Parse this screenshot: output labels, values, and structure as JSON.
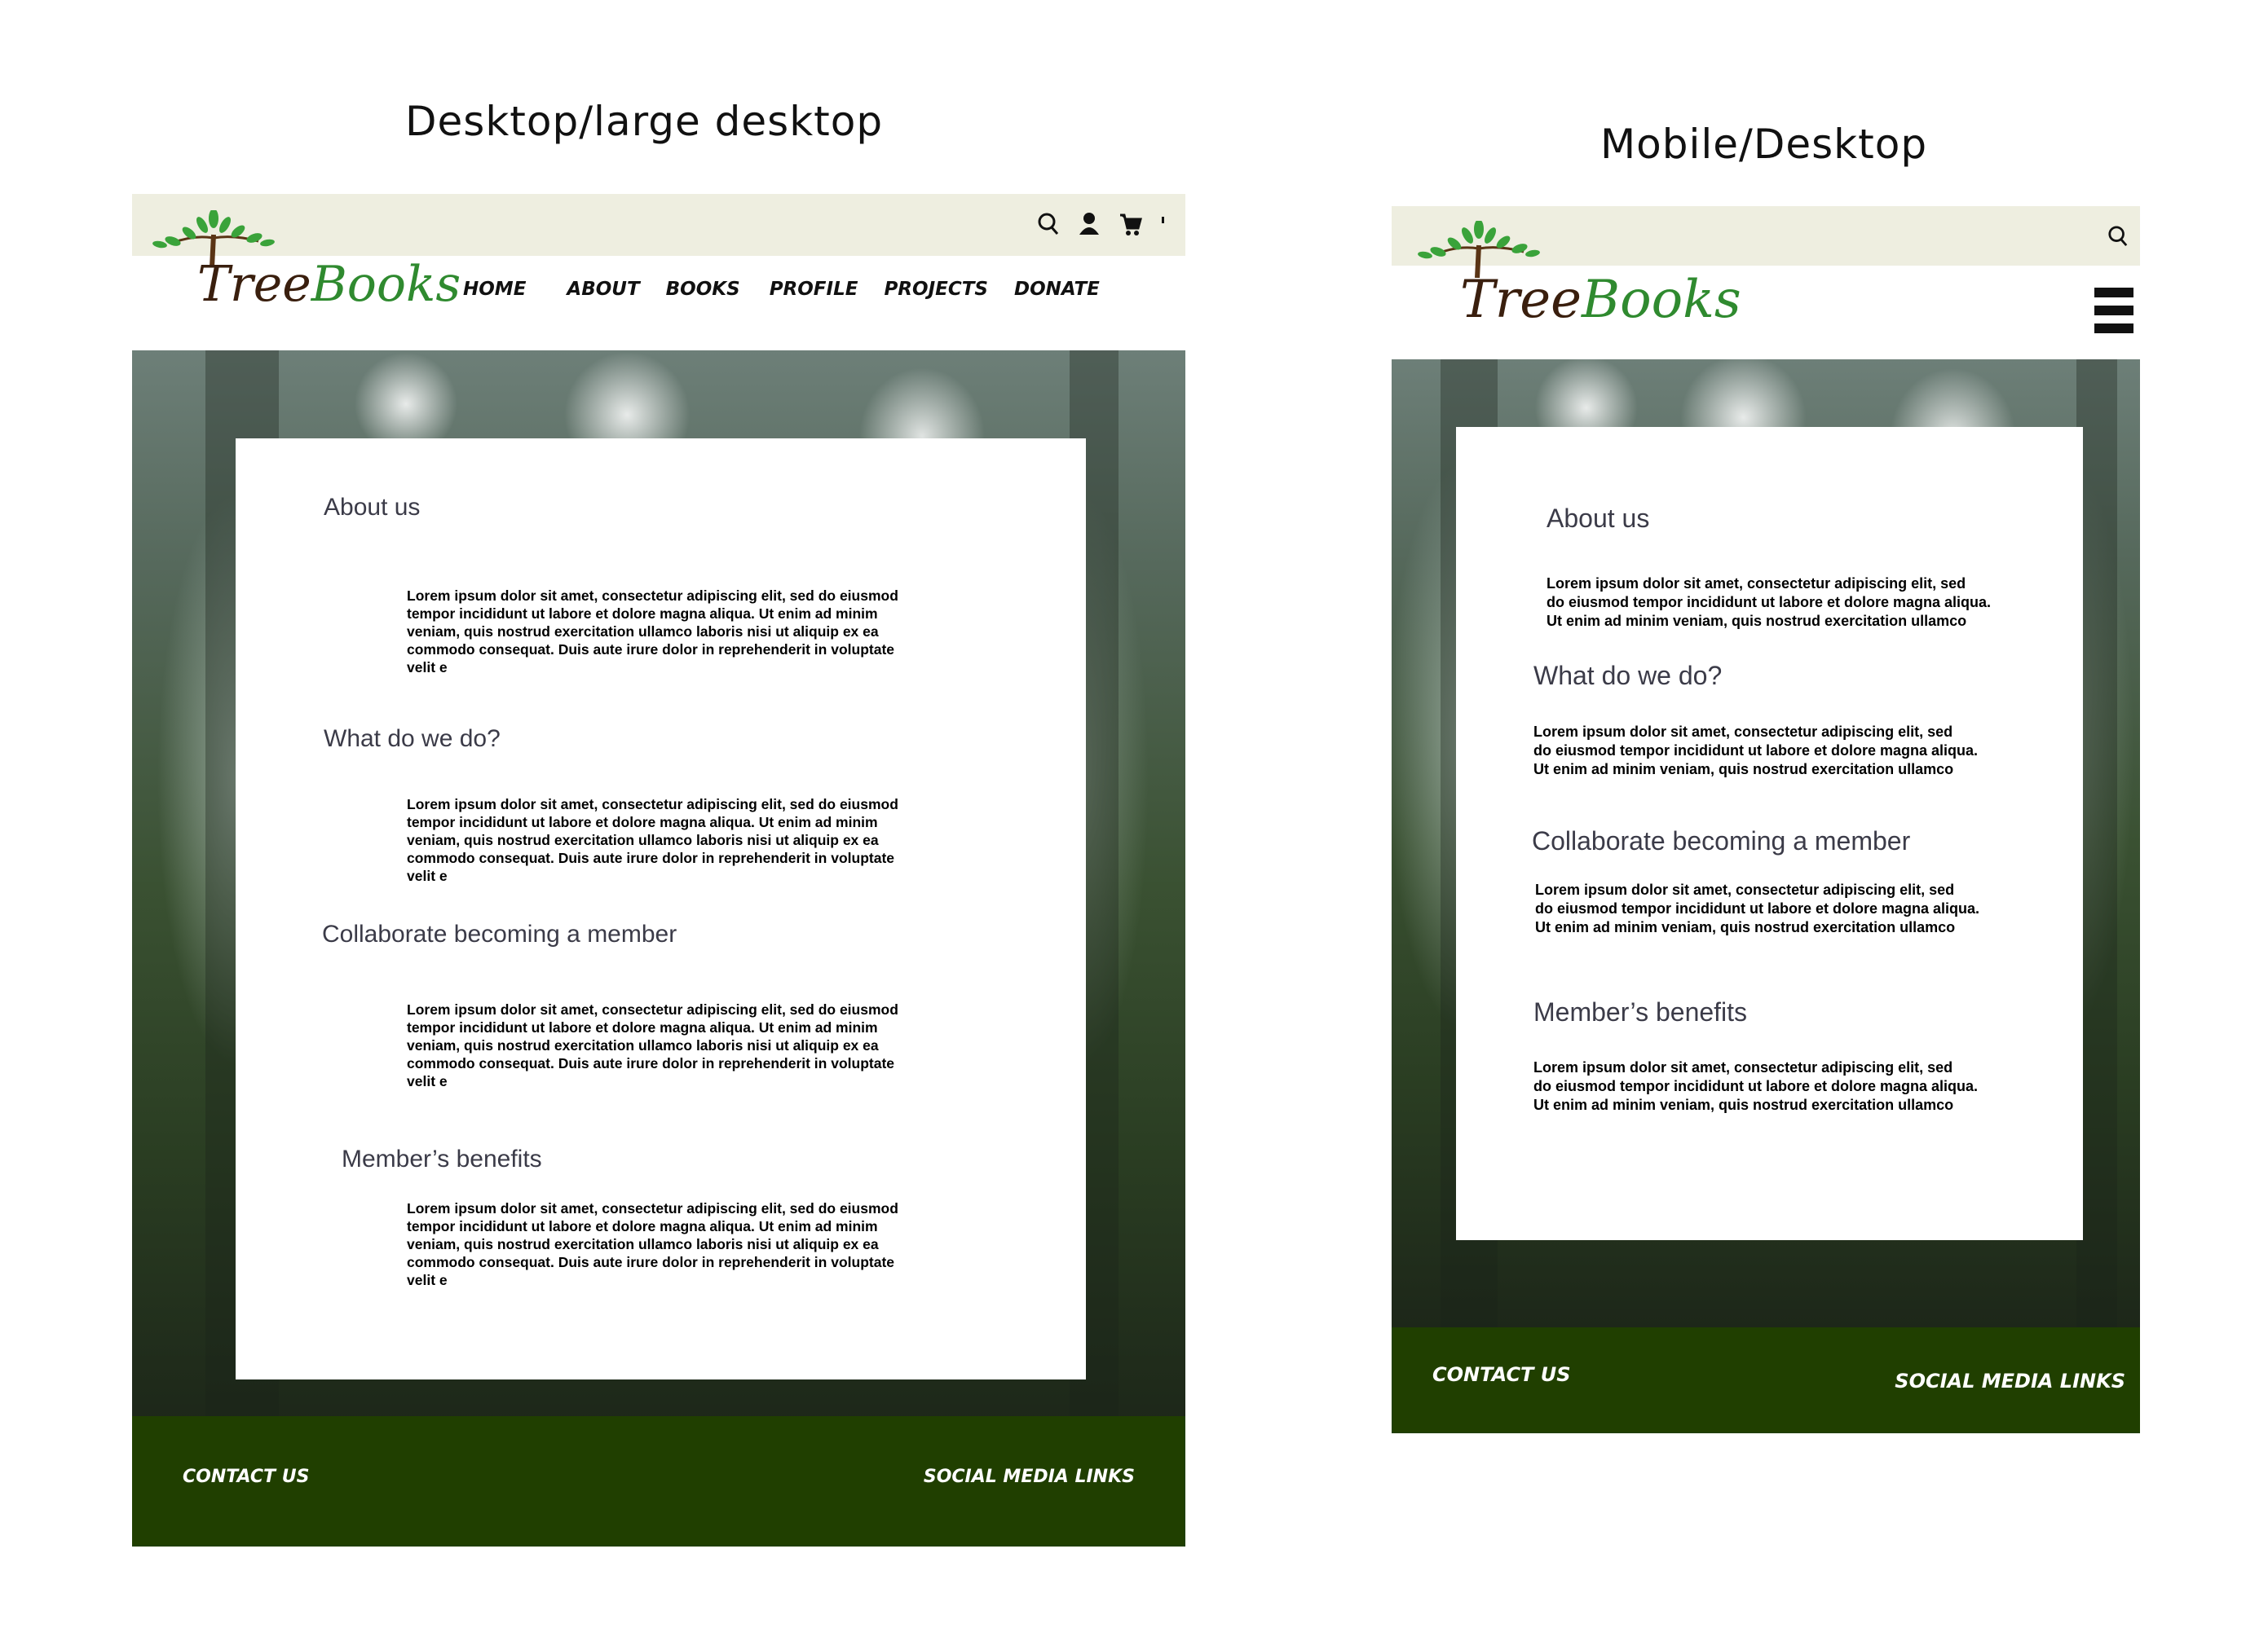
{
  "captions": {
    "desktop": "Desktop/large desktop",
    "mobile": "Mobile/Desktop"
  },
  "brand": {
    "logo_text": "TreeBooks",
    "logo_prefix": "Tree",
    "logo_suffix": "Books"
  },
  "desktop": {
    "header_icons": [
      "search-icon",
      "user-icon",
      "cart-icon"
    ],
    "nav": [
      "HOME",
      "ABOUT",
      "BOOKS",
      "PROFILE",
      "PROJECTS",
      "DONATE"
    ],
    "sections": [
      {
        "heading": "About us",
        "text": "Lorem ipsum dolor sit amet, consectetur adipiscing elit, sed do eiusmod\n tempor incididunt ut labore et dolore magna aliqua. Ut enim ad minim\nveniam, quis nostrud exercitation ullamco laboris nisi ut aliquip ex ea\ncommodo consequat. Duis aute irure dolor in reprehenderit in voluptate\nvelit e"
      },
      {
        "heading": "What do we do?",
        "text": "Lorem ipsum dolor sit amet, consectetur adipiscing elit, sed do eiusmod\n tempor incididunt ut labore et dolore magna aliqua. Ut enim ad minim\nveniam, quis nostrud exercitation ullamco laboris nisi ut aliquip ex ea\ncommodo consequat. Duis aute irure dolor in reprehenderit in voluptate\nvelit e"
      },
      {
        "heading": "Collaborate becoming a member",
        "text": "Lorem ipsum dolor sit amet, consectetur adipiscing elit, sed do eiusmod\n tempor incididunt ut labore et dolore magna aliqua. Ut enim ad minim\nveniam, quis nostrud exercitation ullamco laboris nisi ut aliquip ex ea\ncommodo consequat. Duis aute irure dolor in reprehenderit in voluptate\nvelit e"
      },
      {
        "heading": "Member’s benefits",
        "text": "Lorem ipsum dolor sit amet, consectetur adipiscing elit, sed do eiusmod\n tempor incididunt ut labore et dolore magna aliqua. Ut enim ad minim\nveniam, quis nostrud exercitation ullamco laboris nisi ut aliquip ex ea\ncommodo consequat. Duis aute irure dolor in reprehenderit in voluptate\nvelit e"
      }
    ],
    "footer": {
      "contact": "CONTACT US",
      "social": "SOCIAL MEDIA LINKS"
    }
  },
  "mobile": {
    "header_icons": [
      "search-icon",
      "hamburger-menu-icon"
    ],
    "sections": [
      {
        "heading": "About us",
        "text": "Lorem ipsum dolor sit amet, consectetur adipiscing elit, sed\n do eiusmod tempor incididunt ut labore et dolore magna aliqua.\nUt enim ad minim veniam, quis nostrud exercitation ullamco"
      },
      {
        "heading": "What do we do?",
        "text": "Lorem ipsum dolor sit amet, consectetur adipiscing elit, sed\n do eiusmod tempor incididunt ut labore et dolore magna aliqua.\nUt enim ad minim veniam, quis nostrud exercitation ullamco"
      },
      {
        "heading": "Collaborate becoming a member",
        "text": "Lorem ipsum dolor sit amet, consectetur adipiscing elit, sed\n do eiusmod tempor incididunt ut labore et dolore magna aliqua.\nUt enim ad minim veniam, quis nostrud exercitation ullamco"
      },
      {
        "heading": "Member’s benefits",
        "text": "Lorem ipsum dolor sit amet, consectetur adipiscing elit, sed\n do eiusmod tempor incididunt ut labore et dolore magna aliqua.\nUt enim ad minim veniam, quis nostrud exercitation ullamco"
      }
    ],
    "footer": {
      "contact": "CONTACT US",
      "social": "SOCIAL MEDIA LINKS"
    }
  },
  "colors": {
    "topbar": "#eeeee0",
    "footer": "#203f00",
    "heading": "#3b3b48",
    "logo_green": "#2f8a2f",
    "logo_brown": "#3a1f0e"
  }
}
